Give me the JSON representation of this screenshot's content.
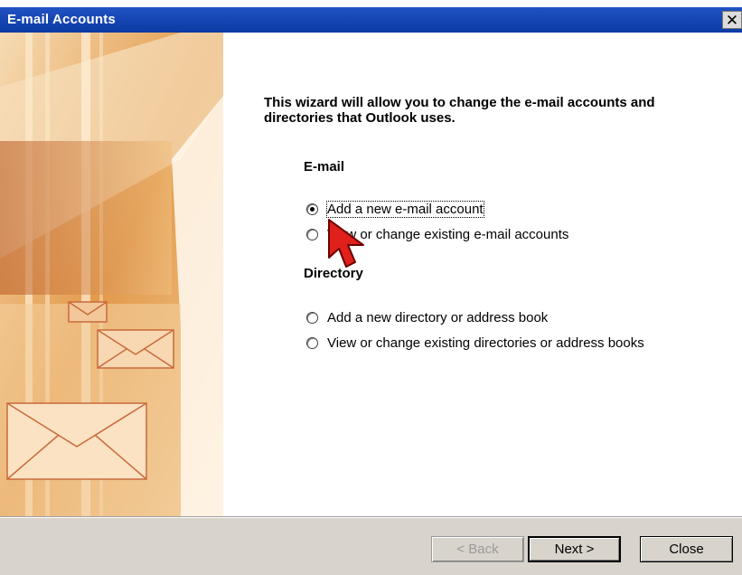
{
  "window": {
    "title": "E-mail Accounts",
    "close_glyph": "✕"
  },
  "intro_text": "This wizard will allow you to change the e-mail accounts and directories that Outlook uses.",
  "email_section": {
    "heading": "E-mail",
    "options": [
      {
        "label": "Add a new e-mail account",
        "selected": true
      },
      {
        "label": "View or change existing e-mail accounts",
        "selected": false
      }
    ]
  },
  "directory_section": {
    "heading": "Directory",
    "options": [
      {
        "label": "Add a new directory or address book",
        "selected": false
      },
      {
        "label": "View or change existing directories or address books",
        "selected": false
      }
    ]
  },
  "buttons": {
    "back": "< Back",
    "next": "Next >",
    "close": "Close"
  },
  "colors": {
    "titlebar": "#0b3aa3",
    "banner": "#e9b478",
    "cursor": "#e0201a",
    "footer": "#d8d4cc"
  }
}
